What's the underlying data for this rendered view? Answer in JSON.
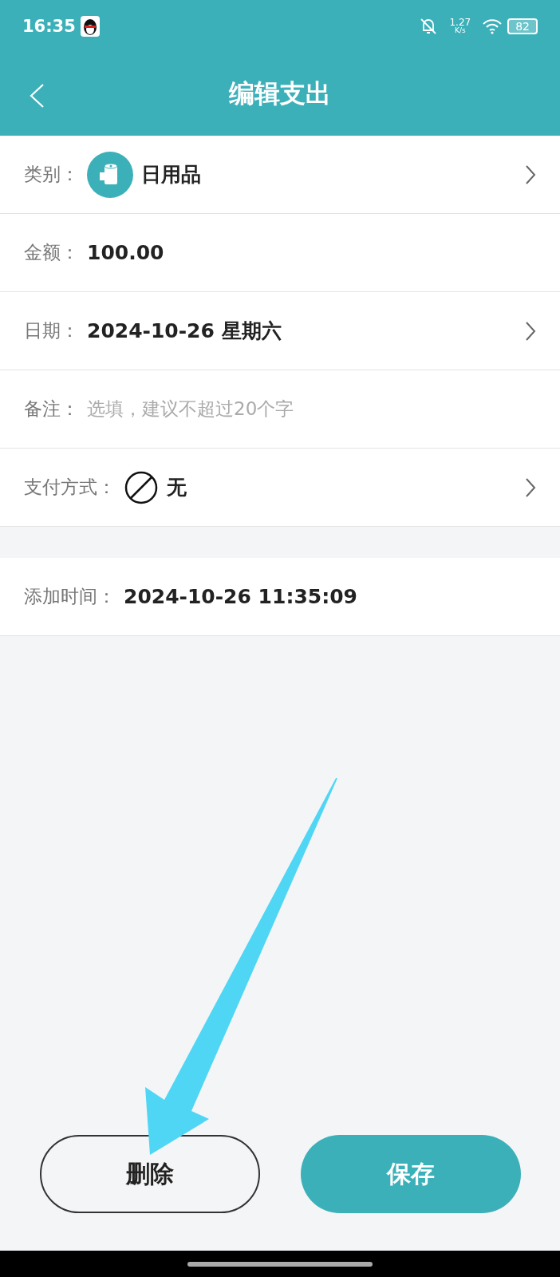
{
  "status_bar": {
    "time": "16:35",
    "net_speed": "1.27",
    "net_unit": "K/s",
    "battery": "82"
  },
  "header": {
    "title": "编辑支出"
  },
  "rows": [
    {
      "kind": "category",
      "label": "类别：",
      "value": "日用品",
      "arrow": true
    },
    {
      "kind": "text",
      "label": "金额：",
      "value": "100.00",
      "arrow": false
    },
    {
      "kind": "text",
      "label": "日期：",
      "value": "2024-10-26 星期六",
      "arrow": true
    },
    {
      "kind": "input",
      "label": "备注：",
      "placeholder": "选填，建议不超过20个字",
      "arrow": false
    },
    {
      "kind": "payment",
      "label": "支付方式：",
      "value": "无",
      "arrow": true
    }
  ],
  "added": {
    "label": "添加时间：",
    "value": "2024-10-26 11:35:09"
  },
  "buttons": {
    "delete": "删除",
    "save": "保存"
  }
}
